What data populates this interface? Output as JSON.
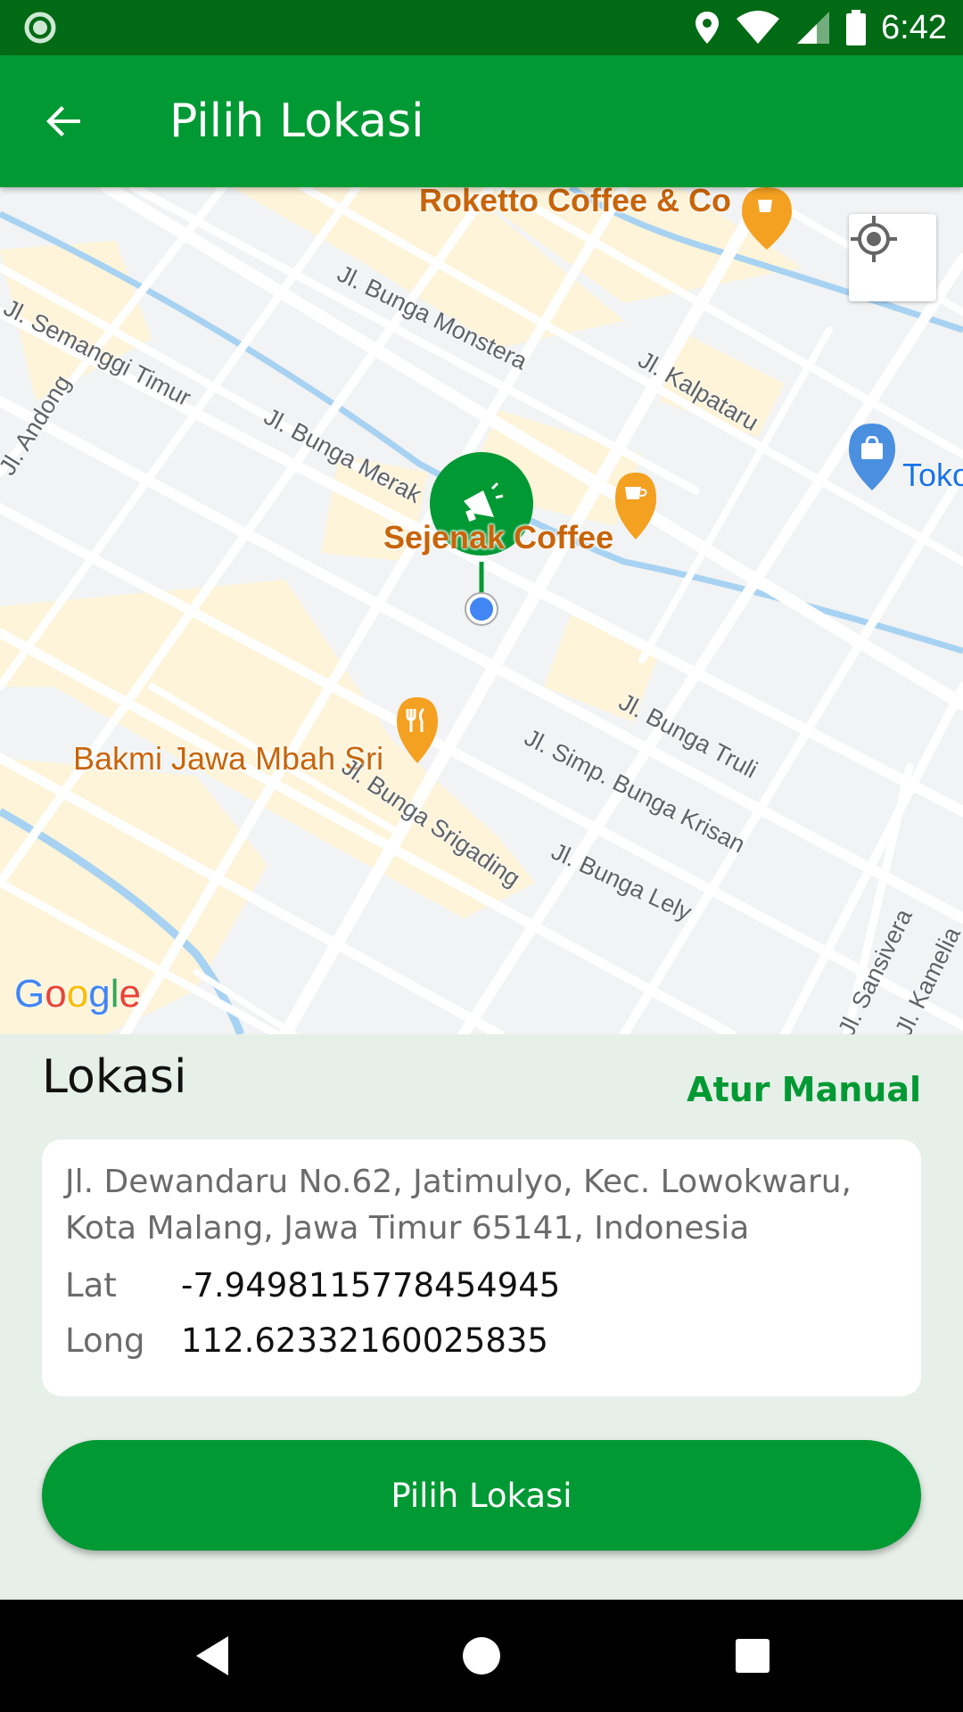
{
  "status_bar": {
    "time": "6:42"
  },
  "app_bar": {
    "title": "Pilih Lokasi"
  },
  "map": {
    "pois": {
      "roketto": "Roketto Coffee & Co",
      "sejenak": "Sejenak Coffee",
      "bakmi": "Bakmi Jawa Mbah Sri",
      "toko": "Toko"
    },
    "streets": {
      "monstera": "Jl. Bunga Monstera",
      "semanggi": "Jl. Semanggi Timur",
      "andong": "Jl. Andong",
      "kalpataru": "Jl. Kalpataru",
      "merak": "Jl. Bunga Merak",
      "truli": "Jl. Bunga Truli",
      "krisan": "Jl. Simp. Bunga Krisan",
      "srigading": "Jl. Bunga Srigading",
      "lely": "Jl. Bunga Lely",
      "sansivera": "Jl. Sansivera",
      "kamelia": "Jl. Kamelia"
    },
    "attribution": "Google"
  },
  "location": {
    "title": "Lokasi",
    "manual_link": "Atur Manual",
    "address": "Jl. Dewandaru No.62, Jatimulyo, Kec. Lowokwaru, Kota Malang, Jawa Timur 65141, Indonesia",
    "lat_label": "Lat",
    "lat_value": "-7.9498115778454945",
    "long_label": "Long",
    "long_value": "112.62332160025835"
  },
  "primary_button": {
    "label": "Pilih Lokasi"
  },
  "colors": {
    "primary": "#009933",
    "status_bar": "#006a14",
    "poi": "#c8650a"
  }
}
